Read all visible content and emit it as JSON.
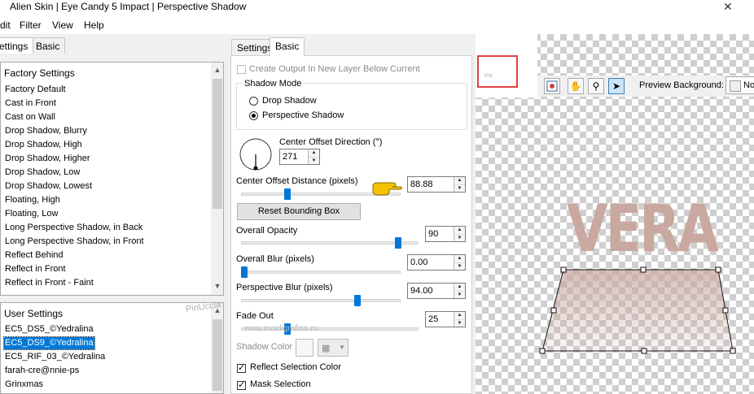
{
  "window": {
    "title": "Alien Skin | Eye Candy 5 Impact | Perspective Shadow",
    "close_glyph": "✕"
  },
  "menu": {
    "items": [
      "dit",
      "Filter",
      "View",
      "Help"
    ]
  },
  "left_tabs": [
    "ettings",
    "Basic"
  ],
  "factory": {
    "header": "Factory Settings",
    "items": [
      "Factory Default",
      "Cast in Front",
      "Cast on Wall",
      "Drop Shadow, Blurry",
      "Drop Shadow, High",
      "Drop Shadow, Higher",
      "Drop Shadow, Low",
      "Drop Shadow, Lowest",
      "Floating, High",
      "Floating, Low",
      "Long Perspective Shadow, in Back",
      "Long Perspective Shadow, in Front",
      "Reflect Behind",
      "Reflect in Front",
      "Reflect in Front - Faint"
    ]
  },
  "user": {
    "header": "User Settings",
    "items": [
      "EC5_DS5_©Yedralina",
      "EC5_DS9_©Yedralina",
      "EC5_RIF_03_©Yedralina",
      "farah-cre@nnie-ps",
      "Grinxmas"
    ],
    "selected_index": 1
  },
  "mid_tabs": [
    "Settings",
    "Basic"
  ],
  "basic": {
    "create_output_label": "Create Output In New Layer Below Current",
    "shadow_mode_label": "Shadow Mode",
    "drop_shadow_label": "Drop Shadow",
    "perspective_shadow_label": "Perspective Shadow",
    "center_offset_direction_label": "Center Offset Direction (°)",
    "center_offset_direction_value": "271",
    "center_offset_distance_label": "Center Offset Distance (pixels)",
    "center_offset_distance_value": "88.88",
    "center_offset_distance_fraction": 0.28,
    "reset_bounding_box_label": "Reset Bounding Box",
    "overall_opacity_label": "Overall Opacity",
    "overall_opacity_value": "90",
    "overall_opacity_fraction": 0.9,
    "overall_blur_label": "Overall Blur (pixels)",
    "overall_blur_value": "0.00",
    "overall_blur_fraction": 0.0,
    "perspective_blur_label": "Perspective Blur (pixels)",
    "perspective_blur_value": "94.00",
    "perspective_blur_fraction": 0.74,
    "fade_out_label": "Fade Out",
    "fade_out_value": "25",
    "fade_out_fraction": 0.25,
    "shadow_color_label": "Shadow Color",
    "reflect_selection_color_label": "Reflect Selection Color",
    "mask_selection_label": "Mask Selection"
  },
  "preview": {
    "background_label": "Preview Background:",
    "background_value": "No",
    "sample_text": "VERA",
    "thumb_text": "Vra"
  },
  "watermark": {
    "line1": "PinUccia",
    "line2": "www.maidigrafica.eu"
  },
  "colors": {
    "selection": "#0078d7",
    "shadow_text": "#c9a8a0",
    "thumb_frame": "#e04040"
  }
}
